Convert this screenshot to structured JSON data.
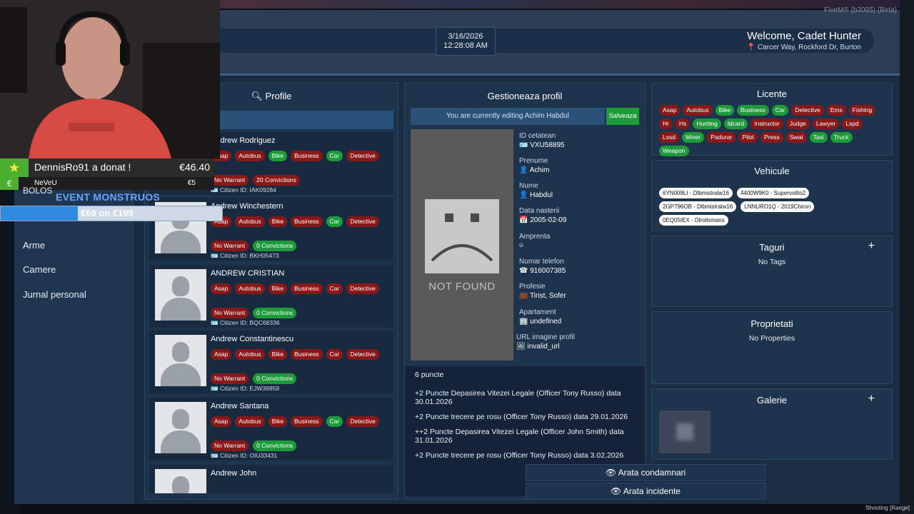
{
  "overlay": {
    "fivem_label": "FiveM® (b3095) (Beta)",
    "shooting_label": "Shooting [Range]"
  },
  "header": {
    "date": "3/16/2026",
    "time": "12:28:08 AM",
    "welcome": "Welcome, Cadet Hunter",
    "location": "Carcer Way, Rockford Dr, Burton"
  },
  "nav": {
    "items": [
      "BOLOS",
      "Arme",
      "Camere",
      "Jurnal personal"
    ]
  },
  "profile_search": {
    "title": "Profile",
    "search_icon": "search-icon"
  },
  "profiles": [
    {
      "name": "Andrew Rodriguez",
      "licenses": [
        {
          "l": "Asap",
          "on": false
        },
        {
          "l": "Autobus",
          "on": false
        },
        {
          "l": "Bike",
          "on": true
        },
        {
          "l": "Business",
          "on": false
        },
        {
          "l": "Car",
          "on": true
        },
        {
          "l": "Detective",
          "on": false
        }
      ],
      "warrant": "No Warrant",
      "convictions": "20 Convictions",
      "convictions_red": true,
      "citizen_id": "Citizen ID: IAK09284"
    },
    {
      "name": "Andrew Winchestern",
      "licenses": [
        {
          "l": "Asap",
          "on": false
        },
        {
          "l": "Autobus",
          "on": false
        },
        {
          "l": "Bike",
          "on": false
        },
        {
          "l": "Business",
          "on": false
        },
        {
          "l": "Car",
          "on": true
        },
        {
          "l": "Detective",
          "on": false
        }
      ],
      "warrant": "No Warrant",
      "convictions": "0 Convictions",
      "convictions_red": false,
      "citizen_id": "Citizen ID: BKH05473"
    },
    {
      "name": "ANDREW CRISTIAN",
      "licenses": [
        {
          "l": "Asap",
          "on": false
        },
        {
          "l": "Autobus",
          "on": false
        },
        {
          "l": "Bike",
          "on": false
        },
        {
          "l": "Business",
          "on": false
        },
        {
          "l": "Car",
          "on": false
        },
        {
          "l": "Detective",
          "on": false
        }
      ],
      "warrant": "No Warrant",
      "convictions": "0 Convictions",
      "convictions_red": false,
      "citizen_id": "Citizen ID: BQC68336"
    },
    {
      "name": "Andrew Constantinescu",
      "licenses": [
        {
          "l": "Asap",
          "on": false
        },
        {
          "l": "Autobus",
          "on": false
        },
        {
          "l": "Bike",
          "on": false
        },
        {
          "l": "Business",
          "on": false
        },
        {
          "l": "Car",
          "on": false
        },
        {
          "l": "Detective",
          "on": false
        }
      ],
      "warrant": "No Warrant",
      "convictions": "0 Convictions",
      "convictions_red": false,
      "citizen_id": "Citizen ID: EJW36959"
    },
    {
      "name": "Andrew Santana",
      "licenses": [
        {
          "l": "Asap",
          "on": false
        },
        {
          "l": "Autobus",
          "on": false
        },
        {
          "l": "Bike",
          "on": false
        },
        {
          "l": "Business",
          "on": false
        },
        {
          "l": "Car",
          "on": true
        },
        {
          "l": "Detective",
          "on": false
        }
      ],
      "warrant": "No Warrant",
      "convictions": "0 Convictions",
      "convictions_red": false,
      "citizen_id": "Citizen ID: OIU33431"
    },
    {
      "name": "Andrew John",
      "licenses": [],
      "warrant": "",
      "convictions": "",
      "convictions_red": false,
      "citizen_id": ""
    }
  ],
  "manage": {
    "title": "Gestioneaza profil",
    "editing": "You are currently editing Achim Habdul",
    "save": "Salveaza",
    "not_found": "NOT FOUND",
    "fields": [
      {
        "label": "ID cetatean",
        "value": "VXU58895",
        "icon": "id-card-icon"
      },
      {
        "label": "Prenume",
        "value": "Achim",
        "icon": "user-icon"
      },
      {
        "label": "Nume",
        "value": "Habdul",
        "icon": "user-icon"
      },
      {
        "label": "Data nasterii",
        "value": "2005-02-09",
        "icon": "calendar-icon"
      },
      {
        "label": "Amprenta",
        "value": "",
        "icon": "fingerprint-icon"
      },
      {
        "label": "Numar telefon",
        "value": "916007385",
        "icon": "phone-icon"
      },
      {
        "label": "Profesie",
        "value": "Tirist, Sofer",
        "icon": "briefcase-icon"
      },
      {
        "label": "Apartament",
        "value": "undefined",
        "icon": "building-icon"
      },
      {
        "label": "URL imagine profil",
        "value": "invalid_url",
        "icon": "image-icon"
      }
    ],
    "points_total": "6 puncte",
    "points": [
      "+2 Puncte Depasirea Vitezei Legale (Officer Tony Russo) data 30.01.2026",
      "+2 Puncte trecere pe rosu (Officer Tony Russo) data 29.01.2026",
      "++2 Puncte Depasirea Vitezei Legale (Officer John Smith) data 31.01.2026",
      "+2 Puncte trecere pe rosu (Officer Tony Russo) data 3.02.2026"
    ]
  },
  "licente": {
    "title": "Licente",
    "items": [
      {
        "l": "Asap",
        "on": false
      },
      {
        "l": "Autobus",
        "on": false
      },
      {
        "l": "Bike",
        "on": true
      },
      {
        "l": "Business",
        "on": true
      },
      {
        "l": "Car",
        "on": true
      },
      {
        "l": "Detective",
        "on": false
      },
      {
        "l": "Ems",
        "on": false
      },
      {
        "l": "Fishing",
        "on": false
      },
      {
        "l": "Hr",
        "on": false
      },
      {
        "l": "Hs",
        "on": false
      },
      {
        "l": "Hunting",
        "on": true
      },
      {
        "l": "Idcard",
        "on": true
      },
      {
        "l": "Instructor",
        "on": false
      },
      {
        "l": "Judge",
        "on": false
      },
      {
        "l": "Lawyer",
        "on": false
      },
      {
        "l": "Lspd",
        "on": false
      },
      {
        "l": "Lssd",
        "on": false
      },
      {
        "l": "Miner",
        "on": true
      },
      {
        "l": "Padurar",
        "on": false
      },
      {
        "l": "Pilot",
        "on": false
      },
      {
        "l": "Press",
        "on": false
      },
      {
        "l": "Swat",
        "on": false
      },
      {
        "l": "Taxi",
        "on": true
      },
      {
        "l": "Truck",
        "on": true
      },
      {
        "l": "Weapon",
        "on": true
      }
    ]
  },
  "vehicule": {
    "title": "Vehicule",
    "items": [
      "6YN009LI - Dlbmistralw16",
      "4400W9K0 - Supervolito2",
      "2GP796OB - Dlbmistralw16",
      "LNNURO1Q - 2019Chiron",
      "0EQ05IEX - Dlrollsmans"
    ]
  },
  "taguri": {
    "title": "Taguri",
    "empty": "No Tags"
  },
  "proprietati": {
    "title": "Proprietati",
    "empty": "No Properties"
  },
  "galerie": {
    "title": "Galerie"
  },
  "actions": {
    "condamnari": "Arata condamnari",
    "incidente": "Arata incidente"
  },
  "stream": {
    "donor": "DennisRo91 a donat !",
    "amount": "€46.40",
    "donor2": "NeVeU",
    "amount2": "€5",
    "event": "EVENT MONSTRUOS",
    "goal_text": "€69 on €199",
    "goal_fraction": 0.347,
    "accent": "#4caf32"
  }
}
